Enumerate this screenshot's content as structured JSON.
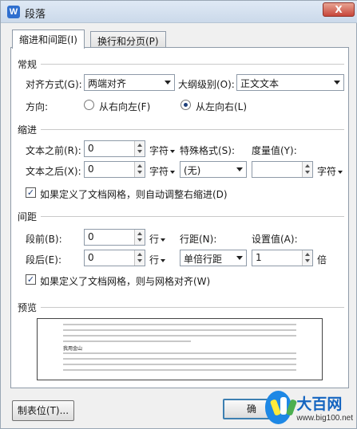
{
  "window": {
    "title": "段落",
    "app_icon_letter": "W",
    "close_glyph": "X"
  },
  "tabs": [
    {
      "label": "缩进和间距(I)",
      "active": true
    },
    {
      "label": "换行和分页(P)",
      "active": false
    }
  ],
  "general": {
    "section_title": "常规",
    "alignment_label": "对齐方式(G):",
    "alignment_value": "两端对齐",
    "outline_label": "大纲级别(O):",
    "outline_value": "正文文本",
    "direction_label": "方向:",
    "rtl_label": "从右向左(F)",
    "ltr_label": "从左向右(L)",
    "direction_selected": "ltr"
  },
  "indent": {
    "section_title": "缩进",
    "before_label": "文本之前(R):",
    "before_value": "0",
    "before_unit": "字符",
    "after_label": "文本之后(X):",
    "after_value": "0",
    "after_unit": "字符",
    "special_label": "特殊格式(S):",
    "special_value": "(无)",
    "measure_label": "度量值(Y):",
    "measure_value": "",
    "measure_unit": "字符",
    "auto_adjust_label": "如果定义了文档网格，则自动调整右缩进(D)",
    "auto_adjust_checked": true
  },
  "spacing": {
    "section_title": "间距",
    "before_label": "段前(B):",
    "before_value": "0",
    "before_unit": "行",
    "after_label": "段后(E):",
    "after_value": "0",
    "after_unit": "行",
    "line_label": "行距(N):",
    "line_value": "单倍行距",
    "setting_label": "设置值(A):",
    "setting_value": "1",
    "setting_unit": "倍",
    "snap_grid_label": "如果定义了文档网格，则与网格对齐(W)",
    "snap_grid_checked": true
  },
  "preview": {
    "section_title": "预览",
    "sample_text": "我用金山"
  },
  "buttons": {
    "tabs_label": "制表位(T)...",
    "ok_label": "确"
  },
  "watermark": {
    "name": "大百网",
    "url": "www.big100.net"
  },
  "colors": {
    "accent": "#3c7fb1",
    "title_bar": "#cbd9ea",
    "close": "#c7463a"
  }
}
